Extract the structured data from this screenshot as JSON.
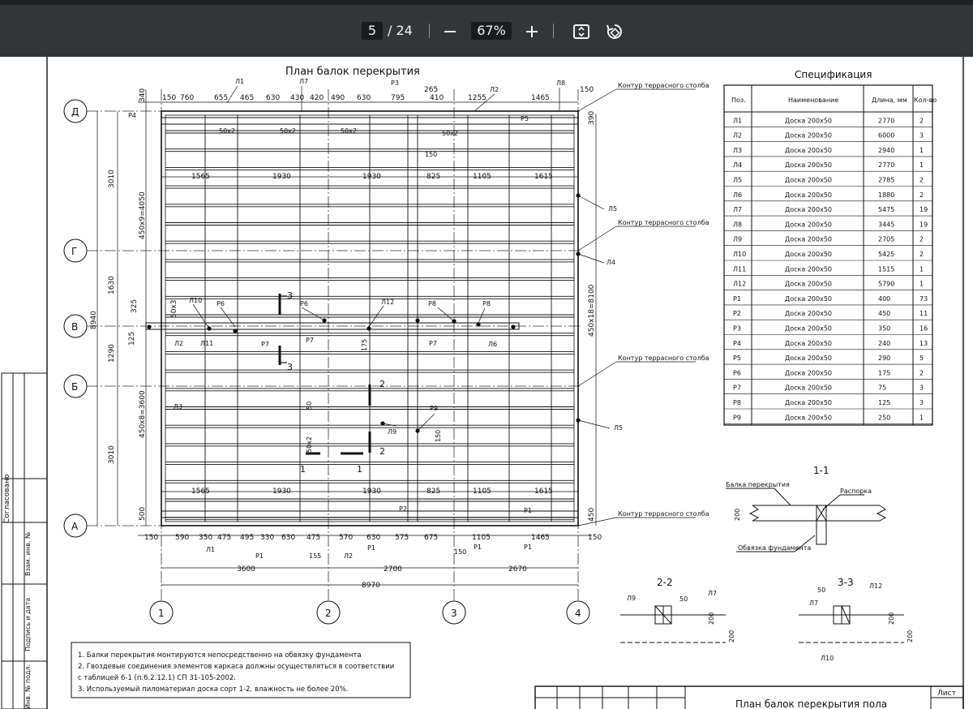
{
  "toolbar": {
    "page_current": "5",
    "page_total": "/ 24",
    "zoom": "67%",
    "icons": [
      "minus-icon",
      "plus-icon",
      "fit-page-icon",
      "rotate-icon"
    ]
  },
  "drawing": {
    "title": "План балок перекрытия",
    "axes_letters": [
      "Д",
      "Г",
      "В",
      "Б",
      "А"
    ],
    "axes_numbers": [
      "1",
      "2",
      "3",
      "4"
    ],
    "top_dims": [
      "150",
      "760",
      "655",
      "465",
      "630",
      "430",
      "420",
      "490",
      "630",
      "795",
      "265",
      "410",
      "1255",
      "1465",
      "150"
    ],
    "bottom_dims": [
      "150",
      "590",
      "350",
      "475",
      "495",
      "330",
      "630",
      "475",
      "570",
      "630",
      "575",
      "675",
      "1105",
      "1465",
      "150"
    ],
    "span_dims": [
      "3600",
      "2700",
      "2670"
    ],
    "total_dim": "8970",
    "left_dims": [
      "340",
      "3010",
      "450x9=4050",
      "1630",
      "325",
      "50x3",
      "8940",
      "1290",
      "125",
      "450x8=3600",
      "3010",
      "500"
    ],
    "right_dims": [
      "390",
      "450x18=8100",
      "450"
    ],
    "row_dims_a": [
      "1565",
      "1930",
      "1930",
      "825",
      "1105",
      "1615"
    ],
    "row_dims_b": [
      "1565",
      "1930",
      "1930",
      "825",
      "1105",
      "1615"
    ],
    "contour_label": "Контур террасного столба",
    "labels": [
      "Л1",
      "Л7",
      "Р3",
      "Л2",
      "Л8",
      "Р4",
      "Р5",
      "50x2",
      "50x2",
      "50x2",
      "50x2",
      "150",
      "Л5",
      "Л4",
      "Л10",
      "Р6",
      "Р6",
      "Л12",
      "Р8",
      "Р8",
      "Л5",
      "Л2",
      "Л11",
      "Р7",
      "Р7",
      "Р7",
      "Л6",
      "Л5",
      "175",
      "Л5",
      "3",
      "3",
      "2",
      "2",
      "50",
      "Р9",
      "Л9",
      "150",
      "50x2",
      "1",
      "1",
      "Л3",
      "Р2",
      "Р1",
      "155",
      "Р1",
      "Л2",
      "Р1",
      "150",
      "Р1",
      "Л1",
      "Р1"
    ],
    "notes": [
      "1.   Балки перекрытия монтируются непосредственно на обвязку фундамента",
      "2.   Гвоздевые соединения элементов каркаса должны осуществляться в соответствии",
      "      с таблицей 6-1 (п.6.2.12.1)  СП  31-105-2002.",
      "3.   Используемый пиломатериал доска сорт 1-2, влажность не более 20%."
    ],
    "stamp_left": [
      "Согласовано",
      "Взам. инв. №",
      "Подпись и дата",
      "Инв. № подл."
    ],
    "stamp_bottom_title": "План балок перекрытия пола",
    "stamp_sheet_label": "Лист"
  },
  "spec": {
    "title": "Спецификация",
    "headers": [
      "Поз.",
      "Наименование",
      "Длина, мм",
      "Кол-во"
    ],
    "rows": [
      [
        "Л1",
        "Доска  200x50",
        "2770",
        "2"
      ],
      [
        "Л2",
        "Доска  200x50",
        "6000",
        "3"
      ],
      [
        "Л3",
        "Доска  200x50",
        "2940",
        "1"
      ],
      [
        "Л4",
        "Доска  200x50",
        "2770",
        "1"
      ],
      [
        "Л5",
        "Доска  200x50",
        "2785",
        "2"
      ],
      [
        "Л6",
        "Доска  200x50",
        "1880",
        "2"
      ],
      [
        "Л7",
        "Доска  200x50",
        "5475",
        "19"
      ],
      [
        "Л8",
        "Доска  200x50",
        "3445",
        "19"
      ],
      [
        "Л9",
        "Доска  200x50",
        "2705",
        "2"
      ],
      [
        "Л10",
        "Доска  200x50",
        "5425",
        "2"
      ],
      [
        "Л11",
        "Доска  200x50",
        "1515",
        "1"
      ],
      [
        "Л12",
        "Доска  200x50",
        "5790",
        "1"
      ],
      [
        "Р1",
        "Доска  200x50",
        "400",
        "73"
      ],
      [
        "Р2",
        "Доска  200x50",
        "450",
        "11"
      ],
      [
        "Р3",
        "Доска  200x50",
        "350",
        "16"
      ],
      [
        "Р4",
        "Доска  200x50",
        "240",
        "13"
      ],
      [
        "Р5",
        "Доска  200x50",
        "290",
        "5"
      ],
      [
        "Р6",
        "Доска  200x50",
        "175",
        "2"
      ],
      [
        "Р7",
        "Доска  200x50",
        "75",
        "3"
      ],
      [
        "Р8",
        "Доска  200x50",
        "125",
        "3"
      ],
      [
        "Р9",
        "Доска  200x50",
        "250",
        "1"
      ]
    ]
  },
  "sections": {
    "s11": {
      "title": "1-1",
      "labels": [
        "Балка перекрытия",
        "Распорка",
        "Обвязка фундамента",
        "200"
      ]
    },
    "s22": {
      "title": "2-2",
      "labels": [
        "Л9",
        "50",
        "Л7",
        "200",
        "200"
      ]
    },
    "s33": {
      "title": "3-3",
      "labels": [
        "50",
        "Л12",
        "Л7",
        "Л10",
        "200",
        "200"
      ]
    }
  }
}
